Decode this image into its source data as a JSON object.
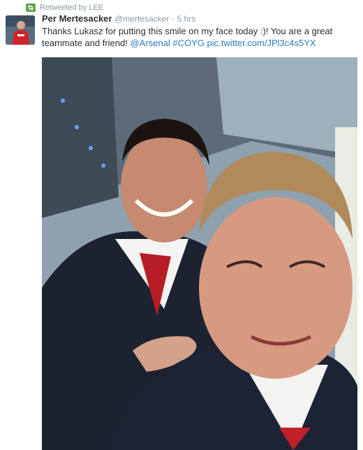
{
  "retweet": {
    "label": "Retweeted by LEE",
    "icon": "retweet-icon"
  },
  "tweet": {
    "author_name": "Per Mertesacker",
    "author_handle": "@mertesacker",
    "separator": "·",
    "time": "5 hrs",
    "text_part1": "Thanks Lukasz for putting this smile on my face today :)! You are a great teammate and friend! ",
    "mention": "@Arsenal",
    "hashtag": "#COYG",
    "media_link": "pic.twitter.com/JPl3c4s5YX"
  },
  "colors": {
    "link": "#2b7bb9",
    "meta": "#8899a6",
    "retweet_green": "#5ea547"
  }
}
